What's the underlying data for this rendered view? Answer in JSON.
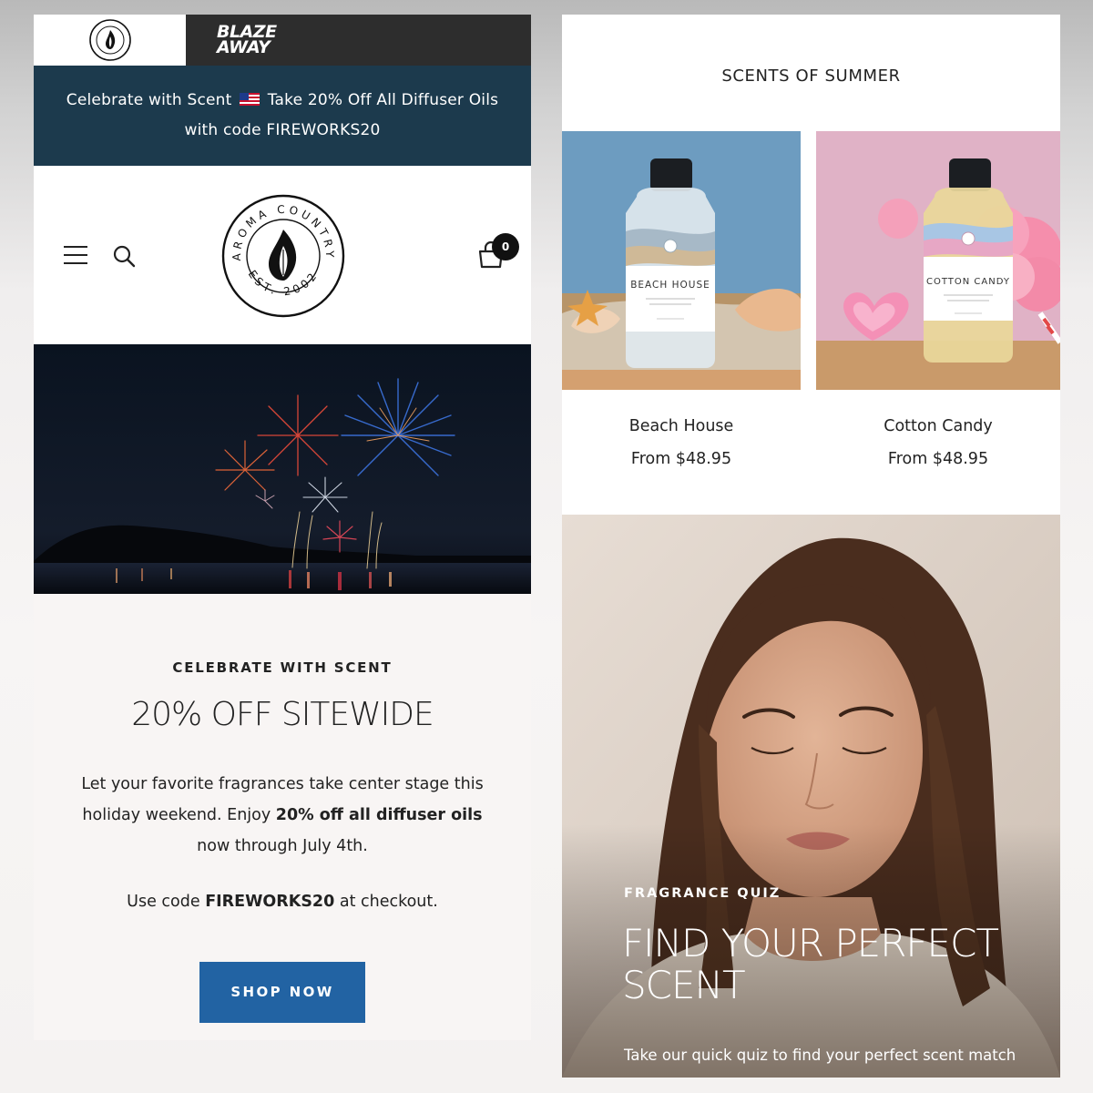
{
  "brand": {
    "small_logo_text": "AROMA COUNTRY · EST. 2002",
    "partner_logo": "BLAZE\nAWAY"
  },
  "announcement": {
    "line1_before_flag": "Celebrate with Scent",
    "flag_icon": "us-flag",
    "line1_after_flag": "Take 20% Off All Diffuser Oils",
    "line2": "with code FIREWORKS20"
  },
  "header": {
    "logo_ring_text": "AROMA COUNTRY",
    "logo_est_text": "EST. 2002",
    "cart_count": "0",
    "icons": [
      "menu-icon",
      "search-icon",
      "cart-icon"
    ]
  },
  "hero": {
    "image": "fireworks-over-lake"
  },
  "promo": {
    "eyebrow": "CELEBRATE WITH SCENT",
    "title": "20% OFF SITEWIDE",
    "body_part1": "Let your favorite fragrances take center stage this holiday weekend. Enjoy ",
    "body_bold": "20% off all diffuser oils",
    "body_part2": " now through July 4th.",
    "code_prefix": "Use code ",
    "code": "FIREWORKS20",
    "code_suffix": " at checkout.",
    "button": "SHOP NOW"
  },
  "summer": {
    "heading": "SCENTS OF SUMMER",
    "products": [
      {
        "name": "Beach House",
        "price": "From $48.95",
        "label": "BEACH HOUSE",
        "bg": "#6d9cc0"
      },
      {
        "name": "Cotton Candy",
        "price": "From $48.95",
        "label": "COTTON CANDY",
        "bg": "#e0b2c6"
      }
    ]
  },
  "quiz": {
    "eyebrow": "FRAGRANCE QUIZ",
    "title": "FIND YOUR PERFECT SCENT",
    "subtitle": "Take our quick quiz to find your perfect scent match"
  },
  "colors": {
    "announce_bg": "#1c3a4d",
    "button_bg": "#2263a3",
    "partner_bg": "#2d2d2d"
  }
}
